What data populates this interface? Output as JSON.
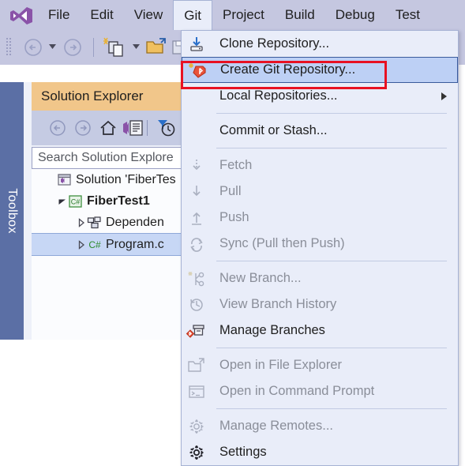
{
  "app": {
    "logo_icon": "visual-studio-logo"
  },
  "menubar": {
    "items": [
      {
        "label": "File",
        "active": false
      },
      {
        "label": "Edit",
        "active": false
      },
      {
        "label": "View",
        "active": false
      },
      {
        "label": "Git",
        "active": true
      },
      {
        "label": "Project",
        "active": false
      },
      {
        "label": "Build",
        "active": false
      },
      {
        "label": "Debug",
        "active": false
      },
      {
        "label": "Test",
        "active": false
      }
    ]
  },
  "toolbar": {
    "buttons": [
      {
        "name": "navigate-back-icon"
      },
      {
        "name": "navigate-back-dropdown-icon"
      },
      {
        "name": "navigate-forward-icon"
      },
      {
        "name": "new-project-icon"
      },
      {
        "name": "new-project-dropdown-icon"
      },
      {
        "name": "open-folder-icon"
      },
      {
        "name": "save-icon"
      }
    ]
  },
  "toolbox": {
    "label": "Toolbox"
  },
  "solution_explorer": {
    "title": "Solution Explorer",
    "toolbar_icons": [
      "back-icon",
      "forward-icon",
      "home-icon",
      "solution-view-icon",
      "pending-changes-filter-icon"
    ],
    "search": {
      "placeholder": "Search Solution Explore"
    },
    "tree": [
      {
        "label": "Solution 'FiberTes",
        "icon": "solution-icon",
        "indent": 18,
        "expander": "none",
        "bold": false,
        "selected": false
      },
      {
        "label": "FiberTest1",
        "icon": "csharp-project-icon",
        "indent": 32,
        "expander": "expanded",
        "bold": true,
        "selected": false
      },
      {
        "label": "Dependen",
        "icon": "dependencies-icon",
        "indent": 56,
        "expander": "collapsed",
        "bold": false,
        "selected": false
      },
      {
        "label": "Program.c",
        "icon": "csharp-file-icon",
        "indent": 56,
        "expander": "collapsed",
        "bold": false,
        "selected": true
      }
    ]
  },
  "git_menu": {
    "sections": [
      {
        "items": [
          {
            "label": "Clone Repository...",
            "icon": "clone-repository-icon",
            "enabled": true,
            "highlighted": false,
            "submenu": false
          },
          {
            "label": "Create Git Repository...",
            "icon": "create-git-repository-icon",
            "enabled": true,
            "highlighted": true,
            "submenu": false
          },
          {
            "label": "Local Repositories...",
            "icon": "none",
            "enabled": true,
            "highlighted": false,
            "submenu": true
          }
        ]
      },
      {
        "items": [
          {
            "label": "Commit or Stash...",
            "icon": "none",
            "enabled": true,
            "highlighted": false,
            "submenu": false
          }
        ]
      },
      {
        "items": [
          {
            "label": "Fetch",
            "icon": "fetch-icon",
            "enabled": false,
            "highlighted": false,
            "submenu": false
          },
          {
            "label": "Pull",
            "icon": "pull-icon",
            "enabled": false,
            "highlighted": false,
            "submenu": false
          },
          {
            "label": "Push",
            "icon": "push-icon",
            "enabled": false,
            "highlighted": false,
            "submenu": false
          },
          {
            "label": "Sync (Pull then Push)",
            "icon": "sync-icon",
            "enabled": false,
            "highlighted": false,
            "submenu": false
          }
        ]
      },
      {
        "items": [
          {
            "label": "New Branch...",
            "icon": "new-branch-icon",
            "enabled": false,
            "highlighted": false,
            "submenu": false
          },
          {
            "label": "View Branch History",
            "icon": "branch-history-icon",
            "enabled": false,
            "highlighted": false,
            "submenu": false
          },
          {
            "label": "Manage Branches",
            "icon": "manage-branches-icon",
            "enabled": true,
            "highlighted": false,
            "submenu": false
          }
        ]
      },
      {
        "items": [
          {
            "label": "Open in File Explorer",
            "icon": "open-file-explorer-icon",
            "enabled": false,
            "highlighted": false,
            "submenu": false
          },
          {
            "label": "Open in Command Prompt",
            "icon": "command-prompt-icon",
            "enabled": false,
            "highlighted": false,
            "submenu": false
          }
        ]
      },
      {
        "items": [
          {
            "label": "Manage Remotes...",
            "icon": "manage-remotes-icon",
            "enabled": false,
            "highlighted": false,
            "submenu": false
          },
          {
            "label": "Settings",
            "icon": "settings-gear-icon",
            "enabled": true,
            "highlighted": false,
            "submenu": false
          }
        ]
      }
    ]
  },
  "annotation": {
    "highlight_color": "#e81123",
    "target": "Create Git Repository..."
  },
  "colors": {
    "menubar_bg": "#c5c7e0",
    "menu_bg": "#e9edf9",
    "selection_blue": "#bdd0f5",
    "solution_title_bg": "#f1c68a",
    "toolbox_bg": "#5b6fa5",
    "vs_purple": "#8a53a8",
    "annotation_red": "#e81123"
  }
}
